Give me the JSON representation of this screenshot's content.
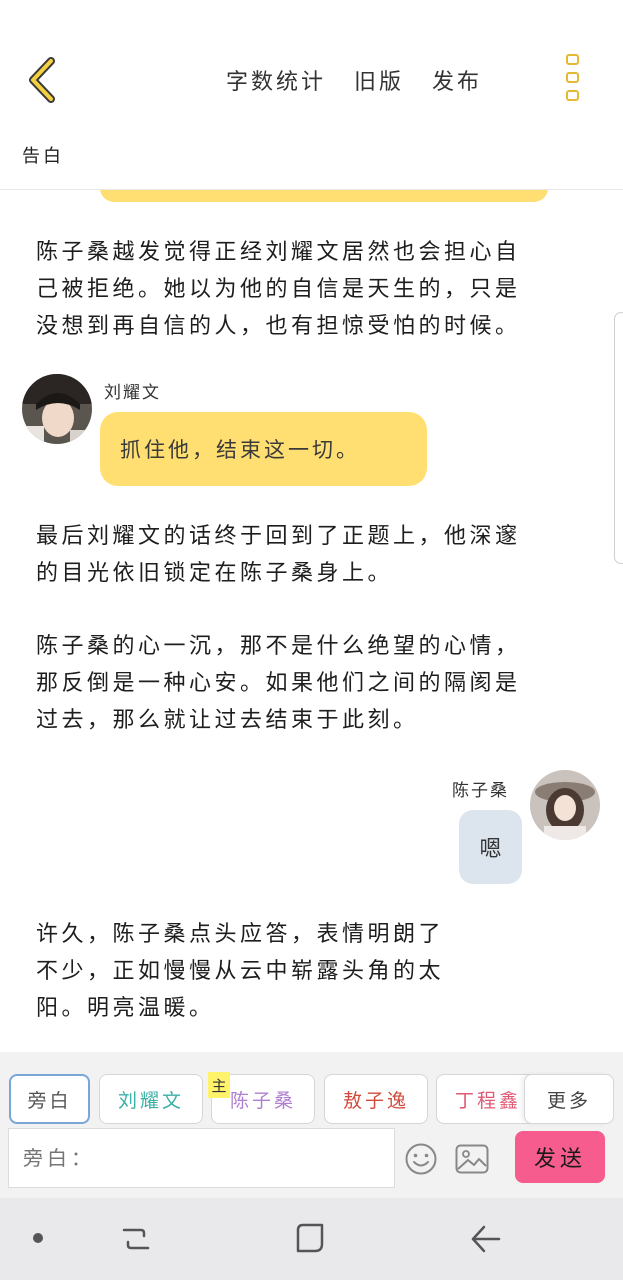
{
  "header": {
    "back_icon": "chevron-left-icon",
    "actions": [
      "字数统计",
      "旧版",
      "发布"
    ],
    "menu_icon": "vertical-dots-icon",
    "title": "告白",
    "accent_color": "#e6b933"
  },
  "content": {
    "paragraph1": [
      "陈子桑越发觉得正经刘耀文居然也会担心自",
      "己被拒绝。她以为他的自信是天生的，只是",
      "没想到再自信的人，也有担惊受怕的时候。"
    ],
    "msg1": {
      "speaker": "刘耀文",
      "text": "抓住他，结束这一切。"
    },
    "paragraph2": [
      "最后刘耀文的话终于回到了正题上，他深邃",
      "的目光依旧锁定在陈子桑身上。"
    ],
    "paragraph3": [
      "陈子桑的心一沉，那不是什么绝望的心情，",
      "那反倒是一种心安。如果他们之间的隔阂是",
      "过去，那么就让过去结束于此刻。"
    ],
    "msg2": {
      "speaker": "陈子桑",
      "text": "嗯"
    },
    "paragraph4": [
      "许久，陈子桑点头应答，表情明朗了",
      "不少，正如慢慢从云中崭露头角的太",
      "阳。明亮温暖。"
    ],
    "bubble_color": "#ffdf72",
    "grey_bubble_color": "#dce4ee"
  },
  "toolbar": {
    "tabs": [
      {
        "label": "旁白",
        "color": "#555555"
      },
      {
        "label": "刘耀文",
        "color": "#3bb0a8"
      },
      {
        "label": "陈子桑",
        "color": "#b07fd0"
      },
      {
        "label": "敖子逸",
        "color": "#d14b3c"
      },
      {
        "label": "丁程鑫",
        "color": "#e05a74"
      }
    ],
    "more_label": "更多",
    "main_badge": "主",
    "input_placeholder": "旁白：",
    "send_label": "发送",
    "send_color": "#f75c8f"
  },
  "navbar": {
    "buttons": [
      "dot-icon",
      "recent-apps-icon",
      "home-icon",
      "back-icon"
    ]
  }
}
